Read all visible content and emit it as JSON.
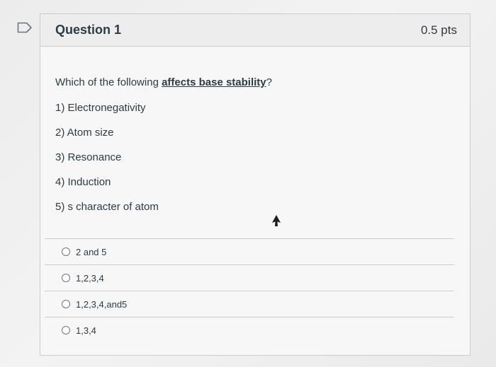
{
  "question": {
    "title": "Question 1",
    "points": "0.5 pts",
    "prompt_before": "Which of the following ",
    "prompt_emphasis": "affects base stability",
    "prompt_after": "?",
    "lines": [
      "1) Electronegativity",
      "2) Atom size",
      "3) Resonance",
      "4) Induction",
      "5) s character of atom"
    ]
  },
  "answers": [
    "2 and 5",
    "1,2,3,4",
    "1,2,3,4,and5",
    "1,3,4"
  ],
  "icons": {
    "flag": "bookmark-flag-icon",
    "cursor": "mouse-pointer-icon",
    "radio": "radio-button"
  }
}
